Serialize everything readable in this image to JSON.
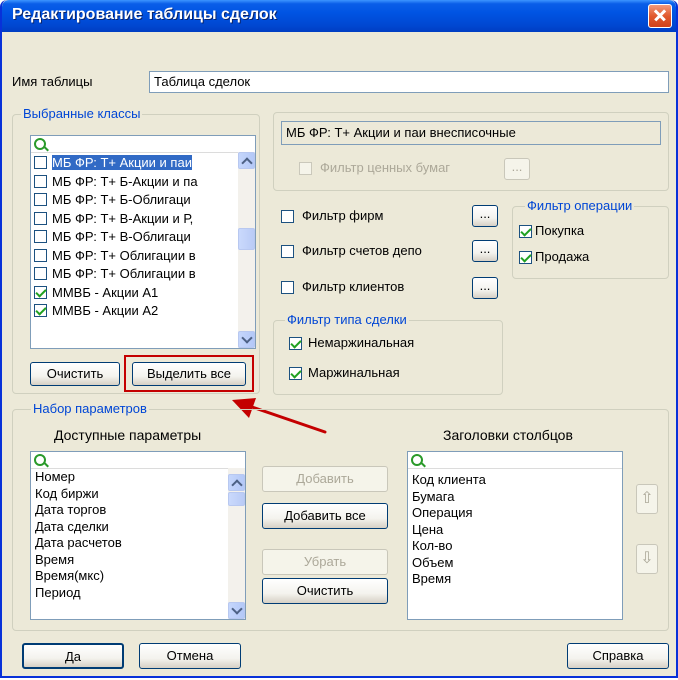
{
  "window": {
    "title": "Редактирование таблицы сделок"
  },
  "table_name": {
    "label": "Имя таблицы",
    "value": "Таблица сделок"
  },
  "selected_classes": {
    "title": "Выбранные классы",
    "search_placeholder": "",
    "items": [
      {
        "label": "МБ ФР: Т+ Акции и паи",
        "checked": false,
        "selected": true
      },
      {
        "label": "МБ ФР: Т+ Б-Акции и па",
        "checked": false
      },
      {
        "label": "МБ ФР: Т+ Б-Облигаци",
        "checked": false
      },
      {
        "label": "МБ ФР: Т+ В-Акции и Р,",
        "checked": false
      },
      {
        "label": "МБ ФР: Т+ В-Облигаци",
        "checked": false
      },
      {
        "label": "МБ ФР: Т+ Облигации в",
        "checked": false
      },
      {
        "label": "МБ ФР: Т+ Облигации в",
        "checked": false
      },
      {
        "label": "ММВБ - Акции А1",
        "checked": true
      },
      {
        "label": "ММВБ - Акции А2",
        "checked": true
      }
    ],
    "clear_button": "Очистить",
    "select_all_button": "Выделить все"
  },
  "class_info": {
    "current_class": "МБ ФР: Т+ Акции и паи внесписочные",
    "securities_filter": "Фильтр ценных бумаг",
    "more_button": "..."
  },
  "filters": {
    "firms": "Фильтр фирм",
    "depo_accounts": "Фильтр счетов депо",
    "clients": "Фильтр клиентов",
    "more_button": "..."
  },
  "operation_filter": {
    "title": "Фильтр операции",
    "buy": "Покупка",
    "sell": "Продажа"
  },
  "deal_type_filter": {
    "title": "Фильтр типа сделки",
    "non_margin": "Немаржинальная",
    "margin": "Маржинальная"
  },
  "parameters": {
    "title": "Набор параметров",
    "available_title": "Доступные параметры",
    "available": [
      "Номер",
      "Код биржи",
      "Дата торгов",
      "Дата сделки",
      "Дата расчетов",
      "Время",
      "Время(мкс)",
      "Период"
    ],
    "columns_title": "Заголовки столбцов",
    "columns": [
      "Код клиента",
      "Бумага",
      "Операция",
      "Цена",
      "Кол-во",
      "Объем",
      "Время"
    ],
    "add": "Добавить",
    "add_all": "Добавить все",
    "remove": "Убрать",
    "clear": "Очистить",
    "up_glyph": "⇧",
    "down_glyph": "⇩"
  },
  "footer": {
    "ok": "Да",
    "cancel": "Отмена",
    "help": "Справка"
  },
  "colors": {
    "highlight": "#c40000",
    "accent": "#0046d5"
  }
}
